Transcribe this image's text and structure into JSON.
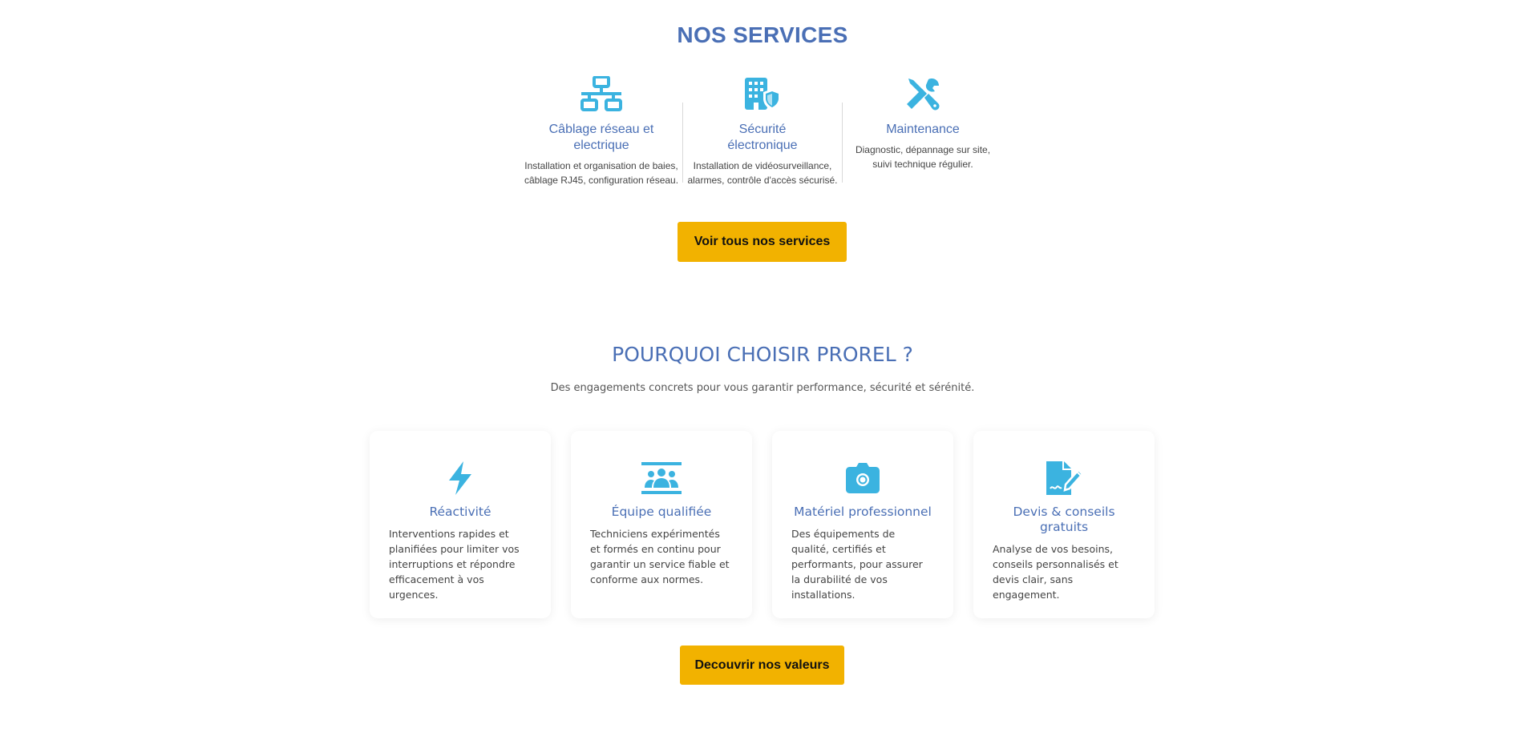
{
  "services": {
    "title": "NOS SERVICES",
    "items": [
      {
        "icon": "network-icon",
        "name": "Câblage réseau et electrique",
        "desc": "Installation et organisation de baies, câblage RJ45, configuration réseau."
      },
      {
        "icon": "building-shield-icon",
        "name": "Sécurité électronique",
        "desc": "Installation de vidéosurveillance, alarmes, contrôle d'accès sécurisé."
      },
      {
        "icon": "tools-icon",
        "name": "Maintenance",
        "desc": "Diagnostic, dépannage sur site, suivi technique régulier."
      }
    ],
    "button_label": "Voir tous nos services"
  },
  "why": {
    "title": "POURQUOI CHOISIR PROREL ?",
    "subtitle": "Des engagements concrets pour vous garantir performance, sécurité et sérénité.",
    "cards": [
      {
        "icon": "bolt-icon",
        "title": "Réactivité",
        "desc": "Interventions rapides et planifiées pour limiter vos interruptions et répondre efficacement à vos urgences."
      },
      {
        "icon": "team-icon",
        "title": "Équipe qualifiée",
        "desc": "Techniciens expérimentés et formés en continu pour garantir un service fiable et conforme aux normes."
      },
      {
        "icon": "camera-icon",
        "title": "Matériel professionnel",
        "desc": "Des équipements de qualité, certifiés et performants, pour assurer la durabilité de vos installations."
      },
      {
        "icon": "file-signature-icon",
        "title": "Devis & conseils gratuits",
        "desc": "Analyse de vos besoins, conseils personnalisés et devis clair, sans engagement."
      }
    ],
    "button_label": "Decouvrir nos valeurs"
  },
  "colors": {
    "heading": "#4a6fb5",
    "icon": "#3bb3e0",
    "button": "#f2b200",
    "divider": "#d9d9d9"
  }
}
